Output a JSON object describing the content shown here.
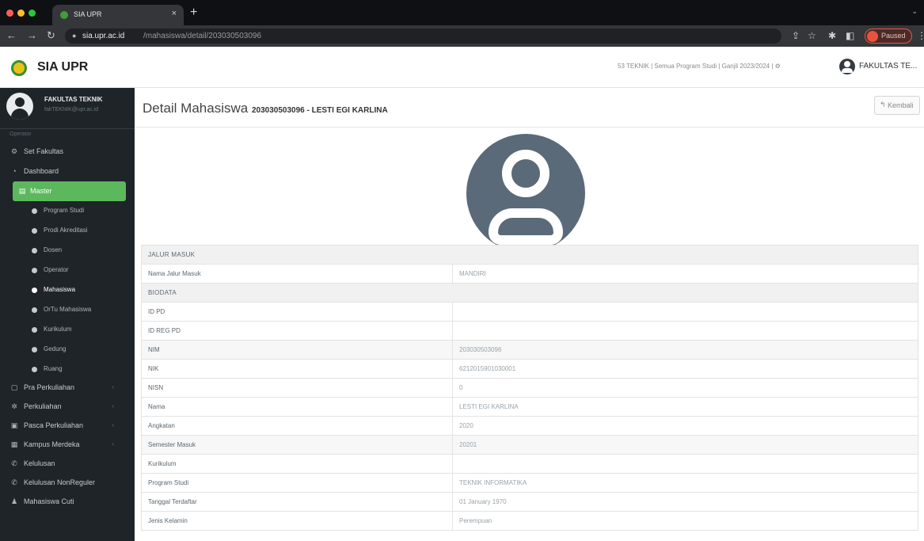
{
  "browser": {
    "tab_title": "SIA UPR",
    "tab_close": "×",
    "new_tab": "+",
    "url_host": "sia.upr.ac.id",
    "url_path": "/mahasiswa/detail/203030503096",
    "profile_status": "Paused"
  },
  "header": {
    "brand": "SIA UPR",
    "context": "53 TEKNIK | Semua Program Studi | Ganjil 2023/2024 | ⚙",
    "user": "FAKULTAS TE..."
  },
  "sidebar": {
    "user_name": "FAKULTAS TEKNIK",
    "user_email": "fakTEKNIK@upr.ac.id",
    "section_label": "Operator",
    "items": [
      {
        "label": "Set Fakultas",
        "icon": "⚙"
      },
      {
        "label": "Dashboard",
        "icon": "◔"
      },
      {
        "label": "Master",
        "icon": "▤"
      }
    ],
    "sub_items": [
      {
        "label": "Program Studi"
      },
      {
        "label": "Prodi Akreditasi"
      },
      {
        "label": "Dosen"
      },
      {
        "label": "Operator"
      },
      {
        "label": "Mahasiswa"
      },
      {
        "label": "OrTu Mahasiswa"
      },
      {
        "label": "Kurikulum"
      },
      {
        "label": "Gedung"
      },
      {
        "label": "Ruang"
      }
    ],
    "lower_items": [
      {
        "label": "Pra Perkuliahan",
        "icon": "▢"
      },
      {
        "label": "Perkuliahan",
        "icon": "✲"
      },
      {
        "label": "Pasca Perkuliahan",
        "icon": "▣"
      },
      {
        "label": "Kampus Merdeka",
        "icon": "▦"
      },
      {
        "label": "Kelulusan",
        "icon": "✆"
      },
      {
        "label": "Kelulusan NonReguler",
        "icon": "✆"
      },
      {
        "label": "Mahasiswa Cuti",
        "icon": "♟"
      }
    ]
  },
  "page": {
    "title": "Detail Mahasiswa",
    "subtitle": "203030503096 - LESTI EGI KARLINA",
    "back_label": "Kembali"
  },
  "details": {
    "section_jalur": "JALUR MASUK",
    "nama_jalur_label": "Nama Jalur Masuk",
    "nama_jalur_value": "MANDIRI",
    "section_biodata": "BIODATA",
    "rows": [
      {
        "label": "ID PD",
        "value": ""
      },
      {
        "label": "ID REG PD",
        "value": ""
      },
      {
        "label": "NIM",
        "value": "203030503096"
      },
      {
        "label": "NIK",
        "value": "6212015901030001"
      },
      {
        "label": "NISN",
        "value": "0"
      },
      {
        "label": "Nama",
        "value": "LESTI EGI KARLINA"
      },
      {
        "label": "Angkatan",
        "value": "2020"
      },
      {
        "label": "Semester Masuk",
        "value": "20201"
      },
      {
        "label": "Kurikulum",
        "value": ""
      },
      {
        "label": "Program Studi",
        "value": "TEKNIK INFORMATIKA"
      },
      {
        "label": "Tanggal Terdaftar",
        "value": "01 January 1970"
      },
      {
        "label": "Jenis Kelamin",
        "value": "Perempuan"
      }
    ]
  }
}
